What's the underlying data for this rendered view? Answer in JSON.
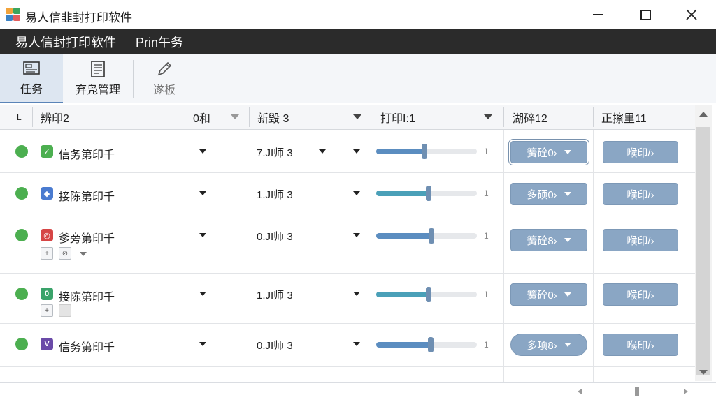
{
  "window": {
    "title": "易人信韭封打印软件"
  },
  "menubar": {
    "items": [
      "易人信封打印软件",
      "Prin午务"
    ]
  },
  "toolbar": {
    "tools": [
      {
        "label": "任务",
        "icon": "task-icon",
        "active": true
      },
      {
        "label": "弃凫管理",
        "icon": "document-list-icon",
        "active": false
      },
      {
        "label": "遂板",
        "icon": "pencil-icon",
        "active": false
      }
    ]
  },
  "table": {
    "headers": [
      "L",
      "辨印2",
      "0和",
      "新毁 3",
      "打印I:1",
      "湖碎12",
      "正擦里11"
    ],
    "rows": [
      {
        "status": "green",
        "icon_color": "#4caf50",
        "icon_glyph": "✓",
        "name": "信务第印千",
        "size": "7.JI师 3",
        "progress": 0.48,
        "fill_color": "#5b8dc0",
        "btn1": "簧砼0›",
        "btn1_selected": true,
        "btn2": "喉印/›",
        "sub_icons": false
      },
      {
        "status": "green",
        "icon_color": "#4a7bd0",
        "icon_glyph": "◆",
        "name": "接陈第印千",
        "size": "1.JI师 3",
        "progress": 0.52,
        "fill_color": "#4aa0b8",
        "btn1": "多硕0›",
        "btn1_selected": false,
        "btn2": "喉印/›",
        "sub_icons": false
      },
      {
        "status": "green",
        "icon_color": "#d64545",
        "icon_glyph": "◎",
        "name": "爹旁第印千",
        "size": "0.JI师 3",
        "progress": 0.55,
        "fill_color": "#5b8dc0",
        "btn1": "簧砼8›",
        "btn1_selected": false,
        "btn2": "喉印/›",
        "sub_icons": true
      },
      {
        "status": "green",
        "icon_color": "#3aa36a",
        "icon_glyph": "0",
        "name": "接陈第印千",
        "size": "1.JI师 3",
        "progress": 0.52,
        "fill_color": "#4aa0b8",
        "btn1": "簧砼0›",
        "btn1_selected": false,
        "btn2": "喉印/›",
        "sub_icons": true
      },
      {
        "status": "green",
        "icon_color": "#6a4aa8",
        "icon_glyph": "V",
        "name": "信务第印千",
        "size": "0.JI师 3",
        "progress": 0.54,
        "fill_color": "#5b8dc0",
        "btn1": "多项8›",
        "btn1_selected": false,
        "btn2": "喉印/›",
        "sub_icons": false
      }
    ]
  },
  "colors": {
    "menubar": "#2b2b2b",
    "accent": "#8aa6c4",
    "status_ok": "#4caf50"
  }
}
